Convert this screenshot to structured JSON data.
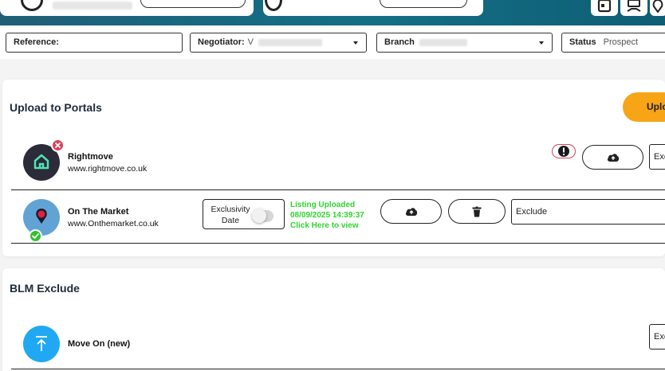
{
  "filters": {
    "reference_label": "Reference:",
    "negotiator_label": "Negotiator:",
    "negotiator_value": "V",
    "branch_label": "Branch",
    "status_label": "Status",
    "status_value": "Prospect"
  },
  "upload_section": {
    "title": "Upload to Portals",
    "upload_button": "Uplo"
  },
  "portals": [
    {
      "name": "Rightmove",
      "url": "www.rightmove.co.uk",
      "exclude_value": "Exc"
    },
    {
      "name": "On The Market",
      "url": "www.Onthemarket.co.uk",
      "exclusivity_label": "Exclusivity Date",
      "status_line1": "Listing Uploaded",
      "status_line2": "08/09/2025 14:39:37",
      "status_line3": "Click Here to view",
      "exclude_value": "Exclude"
    }
  ],
  "blm_section": {
    "title": "BLM Exclude",
    "items": [
      {
        "name": "Move On (new)",
        "exclude_value": "Exc"
      }
    ]
  },
  "colors": {
    "header": "#146f86",
    "accent_orange": "#f7a416",
    "success_green": "#2fd52f",
    "error_red": "#d8435a",
    "rightmove_logo": "#2b2b3a",
    "onthemarket_logo": "#62a3d6",
    "moveon_logo": "#20a9f2"
  }
}
